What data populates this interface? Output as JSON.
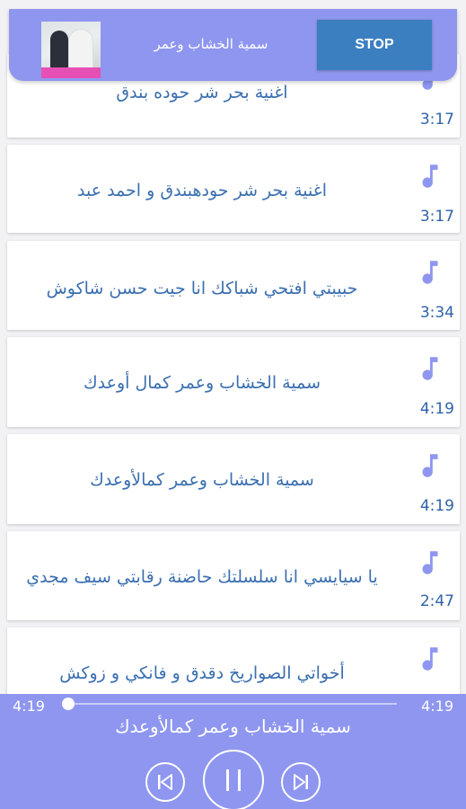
{
  "banner": {
    "title": "سمية الخشاب وعمر",
    "stop_label": "STOP"
  },
  "songs": [
    {
      "title": "اغنية بحر شر حوده بندق",
      "duration": "3:17"
    },
    {
      "title": "اغنية بحر شر حودهبندق و احمد عبد",
      "duration": "3:17"
    },
    {
      "title": "حبيبتي افتحي شباكك انا جيت حسن شاكوش",
      "duration": "3:34"
    },
    {
      "title": "سمية الخشاب وعمر كمال أوعدك",
      "duration": "4:19"
    },
    {
      "title": "سمية الخشاب وعمر كمالأوعدك",
      "duration": "4:19"
    },
    {
      "title": "يا سيايسي انا سلسلتك حاضنة رقابتي سيف مجدي",
      "duration": "2:47"
    },
    {
      "title": "أخواتي الصواريخ دقدق و فانكي و زوكش",
      "duration": ""
    }
  ],
  "player": {
    "elapsed": "4:19",
    "total": "4:19",
    "progress": 0.0,
    "now_playing": "سمية الخشاب وعمر كمالأوعدك"
  },
  "colors": {
    "accent": "#8e96ef",
    "stop_button": "#3b7fc1",
    "song_title": "#3b6fb0",
    "note_icon": "#8e96ef"
  },
  "icons": {
    "song": "music-note-icon",
    "prev": "skip-previous-icon",
    "pause": "pause-icon",
    "next": "skip-next-icon"
  }
}
